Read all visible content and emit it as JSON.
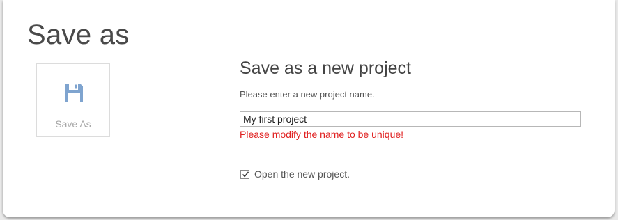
{
  "page": {
    "title": "Save as"
  },
  "tile": {
    "label": "Save As",
    "icon": "floppy-disk-icon",
    "icon_color": "#7fa4cf"
  },
  "form": {
    "heading": "Save as a new project",
    "instruction": "Please enter a new project name.",
    "project_name_value": "My first project",
    "error_message": "Please modify the name to be unique!",
    "error_color": "#e02020",
    "open_project_label": "Open the new project.",
    "open_project_checked": true
  }
}
